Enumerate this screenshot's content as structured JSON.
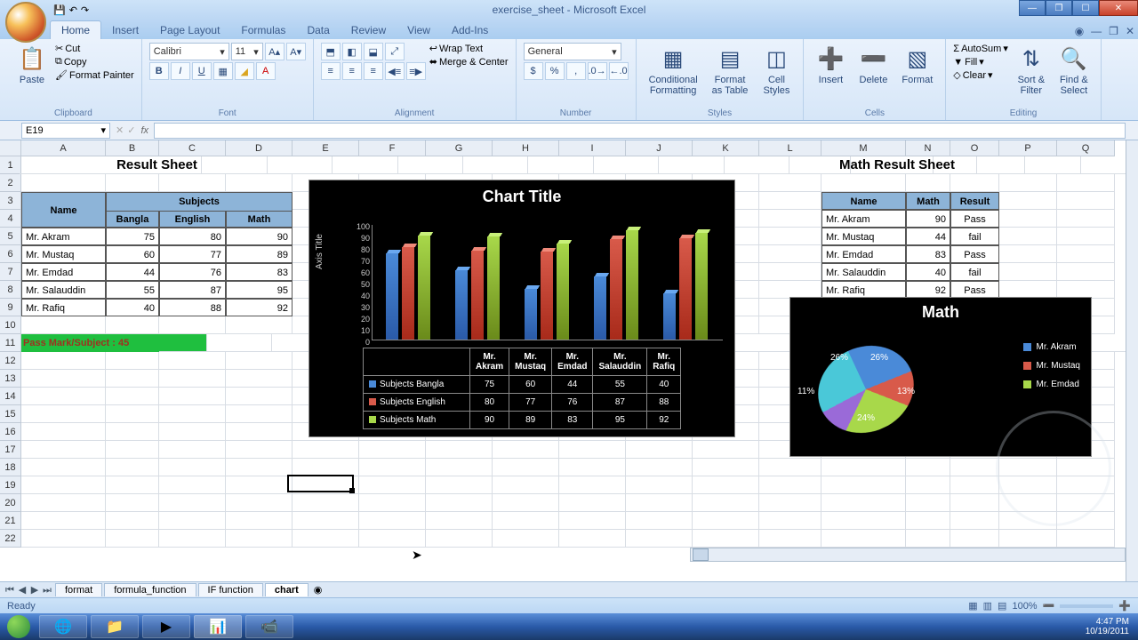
{
  "title": "exercise_sheet - Microsoft Excel",
  "tabs": [
    "Home",
    "Insert",
    "Page Layout",
    "Formulas",
    "Data",
    "Review",
    "View",
    "Add-Ins"
  ],
  "active_tab": "Home",
  "ribbon": {
    "clipboard": {
      "label": "Clipboard",
      "paste": "Paste",
      "cut": "Cut",
      "copy": "Copy",
      "fp": "Format Painter"
    },
    "font": {
      "label": "Font",
      "face": "Calibri",
      "size": "11"
    },
    "alignment": {
      "label": "Alignment",
      "wrap": "Wrap Text",
      "merge": "Merge & Center"
    },
    "number": {
      "label": "Number",
      "format": "General"
    },
    "styles": {
      "label": "Styles",
      "cf": "Conditional\nFormatting",
      "fat": "Format\nas Table",
      "cs": "Cell\nStyles"
    },
    "cells": {
      "label": "Cells",
      "ins": "Insert",
      "del": "Delete",
      "fmt": "Format"
    },
    "editing": {
      "label": "Editing",
      "asum": "AutoSum",
      "fill": "Fill",
      "clear": "Clear",
      "sort": "Sort &\nFilter",
      "find": "Find &\nSelect"
    }
  },
  "name_box": "E19",
  "columns": [
    "A",
    "B",
    "C",
    "D",
    "E",
    "F",
    "G",
    "H",
    "I",
    "J",
    "K",
    "L",
    "M",
    "N",
    "O",
    "P",
    "Q"
  ],
  "result_title": "Result Sheet",
  "math_title": "Math Result Sheet",
  "table1": {
    "hdr_name": "Name",
    "hdr_subjects": "Subjects",
    "hdr_bangla": "Bangla",
    "hdr_english": "English",
    "hdr_math": "Math",
    "rows": [
      {
        "name": "Mr. Akram",
        "b": 75,
        "e": 80,
        "m": 90
      },
      {
        "name": "Mr. Mustaq",
        "b": 60,
        "e": 77,
        "m": 89
      },
      {
        "name": "Mr. Emdad",
        "b": 44,
        "e": 76,
        "m": 83
      },
      {
        "name": "Mr. Salauddin",
        "b": 55,
        "e": 87,
        "m": 95
      },
      {
        "name": "Mr. Rafiq",
        "b": 40,
        "e": 88,
        "m": 92
      }
    ]
  },
  "pass_mark": "Pass Mark/Subject : 45",
  "table2": {
    "hdr_name": "Name",
    "hdr_math": "Math",
    "hdr_result": "Result",
    "rows": [
      {
        "name": "Mr. Akram",
        "m": 90,
        "r": "Pass"
      },
      {
        "name": "Mr. Mustaq",
        "m": 44,
        "r": "fail"
      },
      {
        "name": "Mr. Emdad",
        "m": 83,
        "r": "Pass"
      },
      {
        "name": "Mr. Salauddin",
        "m": 40,
        "r": "fail"
      },
      {
        "name": "Mr. Rafiq",
        "m": 92,
        "r": "Pass"
      }
    ]
  },
  "chart_data": [
    {
      "type": "bar",
      "title": "Chart Title",
      "ylabel": "Axis Title",
      "ylim": [
        0,
        100
      ],
      "yticks": [
        100,
        90,
        80,
        70,
        60,
        50,
        40,
        30,
        20,
        10,
        0
      ],
      "categories": [
        "Mr. Akram",
        "Mr. Mustaq",
        "Mr. Emdad",
        "Mr. Salauddin",
        "Mr. Rafiq"
      ],
      "series": [
        {
          "name": "Subjects Bangla",
          "values": [
            75,
            60,
            44,
            55,
            40
          ]
        },
        {
          "name": "Subjects English",
          "values": [
            80,
            77,
            76,
            87,
            88
          ]
        },
        {
          "name": "Subjects Math",
          "values": [
            90,
            89,
            83,
            95,
            92
          ]
        }
      ]
    },
    {
      "type": "pie",
      "title": "Math",
      "slices": [
        {
          "name": "Mr. Akram",
          "pct": "26%"
        },
        {
          "name": "Mr. Mustaq",
          "pct": "13%"
        },
        {
          "name": "Mr. Emdad",
          "pct": "24%"
        },
        {
          "name": "Mr. Salauddin",
          "pct": "11%"
        },
        {
          "name": "Mr. Rafiq",
          "pct": "26%"
        }
      ],
      "legend": [
        "Mr. Akram",
        "Mr. Mustaq",
        "Mr. Emdad"
      ]
    }
  ],
  "sheet_tabs": [
    "format",
    "formula_function",
    "IF function",
    "chart"
  ],
  "active_sheet": "chart",
  "status": "Ready",
  "zoom": "100%",
  "clock": {
    "time": "4:47 PM",
    "date": "10/19/2011"
  }
}
